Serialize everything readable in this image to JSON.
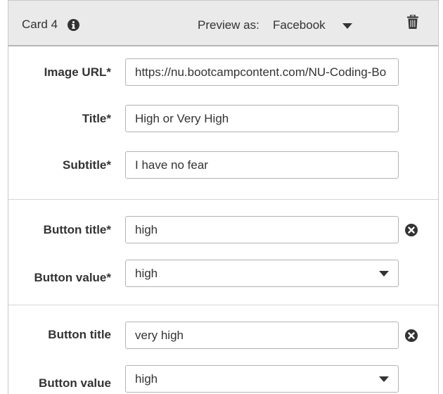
{
  "header": {
    "card_title": "Card 4",
    "preview_label": "Preview as:",
    "preview_value": "Facebook"
  },
  "fields": {
    "image_url": {
      "label": "Image URL*",
      "value": "https://nu.bootcampcontent.com/NU-Coding-Bo"
    },
    "title": {
      "label": "Title*",
      "value": "High or Very High"
    },
    "subtitle": {
      "label": "Subtitle*",
      "value": "I have no fear"
    }
  },
  "buttons": [
    {
      "title_label": "Button title*",
      "title_value": "high",
      "value_label": "Button value*",
      "value_value": "high"
    },
    {
      "title_label": "Button title",
      "title_value": "very high",
      "value_label": "Button value",
      "value_value": "high"
    }
  ],
  "colors": {
    "header_bg": "#eaeaea",
    "icon": "#333333",
    "border": "#b3b3b3"
  },
  "icons": {
    "info": "info-icon",
    "dropdown": "chevron-down-icon",
    "delete": "trash-icon",
    "remove": "remove-circle-icon"
  }
}
